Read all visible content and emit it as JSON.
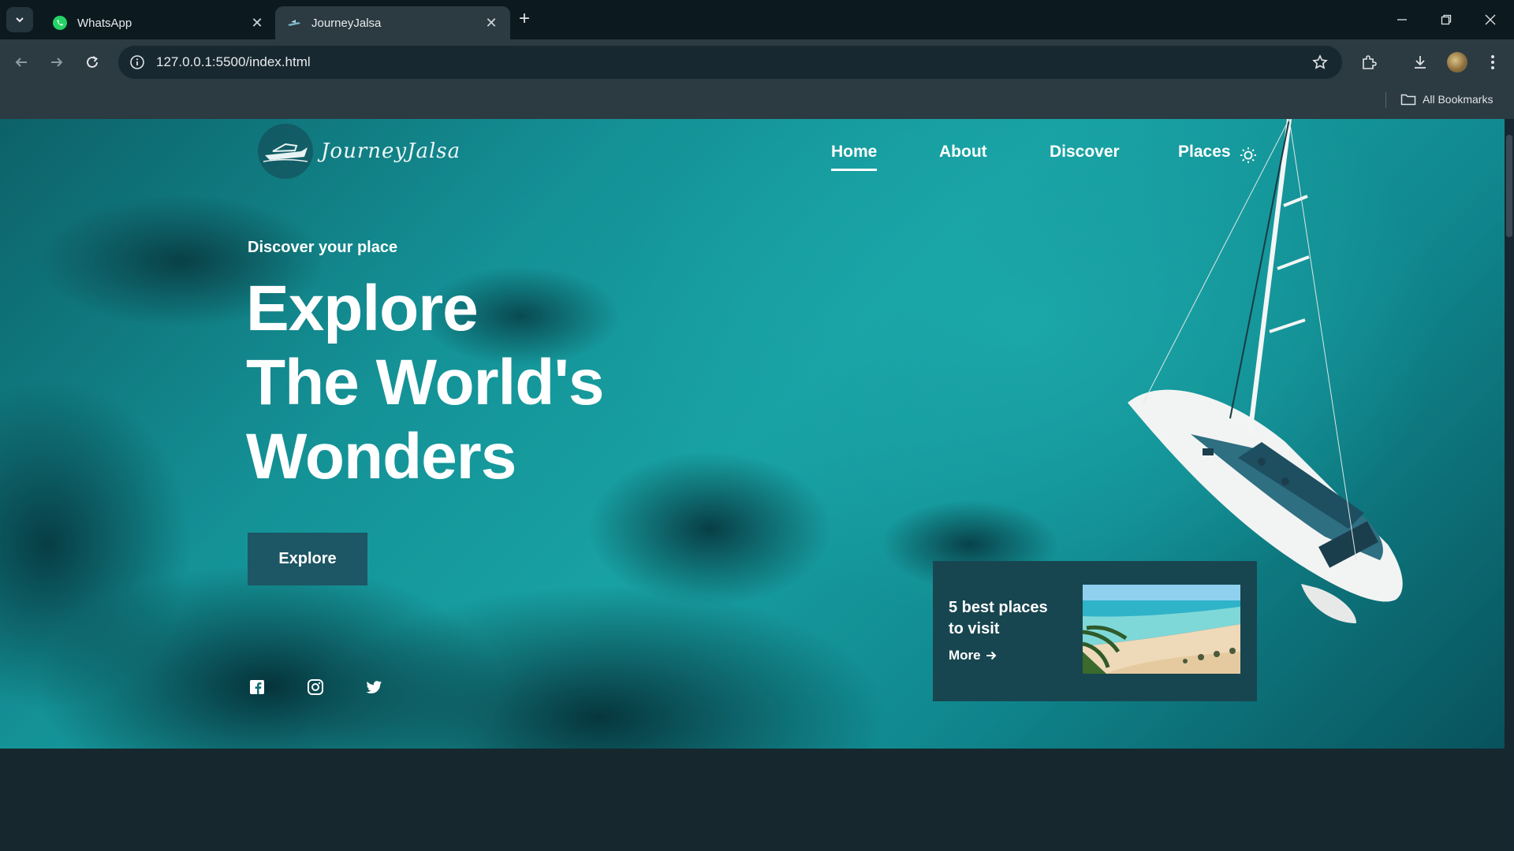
{
  "browser": {
    "tabs": [
      {
        "title": "WhatsApp",
        "icon": "whatsapp-icon",
        "active": false
      },
      {
        "title": "JourneyJalsa",
        "icon": "site-favicon-icon",
        "active": true
      }
    ],
    "address_bar": {
      "url": "127.0.0.1:5500/index.html"
    },
    "bookmarks_bar": {
      "all_bookmarks_label": "All Bookmarks"
    }
  },
  "site": {
    "logo_text": "JourneyJalsa",
    "nav": [
      {
        "label": "Home",
        "active": true
      },
      {
        "label": "About",
        "active": false
      },
      {
        "label": "Discover",
        "active": false
      },
      {
        "label": "Places",
        "active": false
      }
    ],
    "hero": {
      "subtitle": "Discover your place",
      "title_line1": "Explore",
      "title_line2_regular": "The",
      "title_line2_bold": "World's",
      "title_line3": "Wonders",
      "cta_label": "Explore"
    },
    "social_icons": [
      "facebook-icon",
      "instagram-icon",
      "twitter-icon"
    ],
    "card": {
      "title": "5 best places to visit",
      "more_label": "More"
    }
  },
  "colors": {
    "tabstrip": "#0c1a20",
    "toolbar": "#2c3a42",
    "button_bg": "#1d5664",
    "card_bg": "#184650",
    "page_bottom": "#16272e"
  }
}
